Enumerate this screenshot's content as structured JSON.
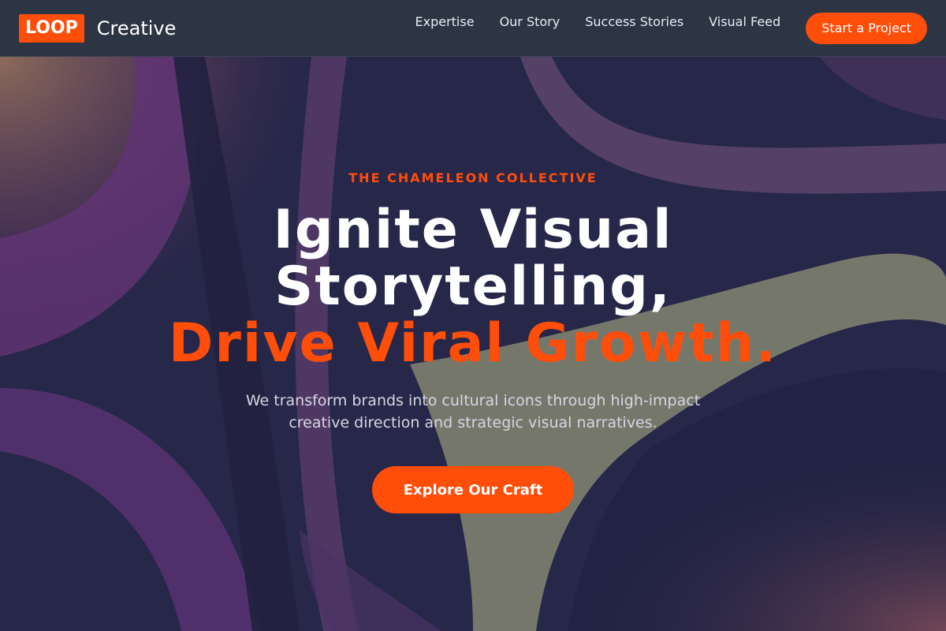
{
  "brand": {
    "badge": "LOOP",
    "wordmark": "Creative"
  },
  "nav": {
    "links": [
      "Expertise",
      "Our Story",
      "Success Stories",
      "Visual Feed"
    ],
    "cta_label": "Start a Project"
  },
  "hero": {
    "eyebrow": "THE CHAMELEON COLLECTIVE",
    "headline_line1": "Ignite Visual",
    "headline_line2": "Storytelling,",
    "headline_accent": "Drive Viral Growth.",
    "subtext": "We transform brands into cultural icons through high-impact creative direction and strategic visual narratives.",
    "button_label": "Explore Our Craft"
  },
  "colors": {
    "accent": "#ff4d0a",
    "header_bg": "#2c3544",
    "hero_bg": "#2a2b4a"
  }
}
